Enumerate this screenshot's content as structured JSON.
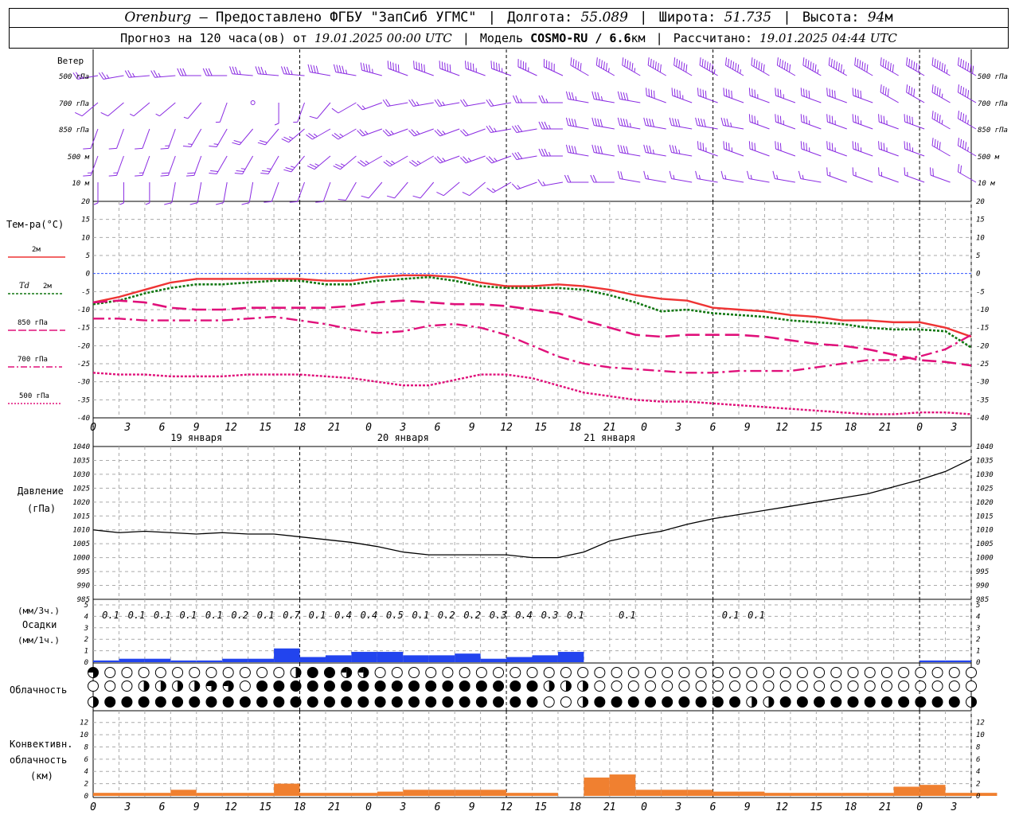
{
  "header": {
    "location": "Orenburg",
    "provider": "— Предоставлено ФГБУ \"ЗапСиб УГМС\"",
    "lon_label": "Долгота:",
    "lon_value": "55.089",
    "lat_label": "Широта:",
    "lat_value": "51.735",
    "alt_label": "Высота:",
    "alt_value": "94",
    "alt_unit": "м",
    "forecast_prefix": "Прогноз на 120 часа(ов) от",
    "forecast_time": "19.01.2025 00:00 UTC",
    "model_label": "Модель",
    "model_name": "COSMO-RU / 6.6",
    "model_unit": "км",
    "calc_label": "Рассчитано:",
    "calc_time": "19.01.2025 04:44 UTC"
  },
  "labels": {
    "wind": "Ветер",
    "wind_levels": [
      "500 гПа",
      "700 гПа",
      "850 гПа",
      "500 м",
      "10 м"
    ],
    "temp_title": "Тем-ра(°C)",
    "temp_2m": "2м",
    "td_italic": "Td",
    "td_2m": "2м",
    "t850": "850 гПа",
    "t700": "700 гПа",
    "t500": "500 гПа",
    "pressure_1": "Давление",
    "pressure_2": "(гПа)",
    "precip_unit_1": "(мм/3ч.)",
    "precip_name": "Осадки",
    "precip_unit_2": "(мм/1ч.)",
    "cloud": "Облачность",
    "conv_1": "Конвективн.",
    "conv_2": "облачность",
    "conv_3": "(км)"
  },
  "colors": {
    "wind": "#8a2be2",
    "t2m": "#ee3333",
    "td": "#117711",
    "t850": "#e0107a",
    "t700": "#e0107a",
    "t500": "#e0107a",
    "zero_line": "#3355ff",
    "pressure": "#000000",
    "precip": "#2244ee",
    "conv": "#f08030",
    "grid": "#aaaaaa"
  },
  "chart_data": [
    {
      "panel": "wind",
      "type": "wind_barbs",
      "levels": [
        "500 гПа",
        "700 гПа",
        "850 гПа",
        "500 м",
        "10 м"
      ],
      "hours": [
        0,
        3,
        6,
        9,
        12,
        15,
        18,
        21,
        24,
        27,
        30,
        33,
        36,
        39,
        42,
        45,
        48,
        51,
        54,
        57,
        60,
        63,
        66,
        69,
        72,
        75,
        78,
        81,
        84,
        87,
        90,
        93,
        96,
        99,
        102
      ],
      "speed_ms": {
        "500 гПа": [
          12,
          12,
          13,
          14,
          15,
          16,
          17,
          18,
          18,
          20,
          22,
          24,
          25,
          25,
          25,
          24,
          24,
          24,
          25,
          26,
          27,
          28,
          30,
          30,
          32,
          32,
          30,
          30,
          32,
          32,
          30,
          30,
          30,
          32,
          35
        ],
        "700 гПа": [
          6,
          5,
          4,
          4,
          2,
          2,
          1,
          2,
          3,
          5,
          6,
          8,
          10,
          12,
          12,
          10,
          10,
          12,
          14,
          18,
          18,
          20,
          20,
          22,
          20,
          20,
          18,
          18,
          20,
          20,
          20,
          20,
          20,
          22,
          25
        ],
        "850 гПа": [
          6,
          6,
          6,
          8,
          8,
          8,
          10,
          10,
          12,
          12,
          12,
          14,
          12,
          12,
          12,
          10,
          12,
          15,
          18,
          20,
          20,
          22,
          20,
          20,
          20,
          18,
          18,
          18,
          18,
          18,
          18,
          18,
          20,
          22,
          22
        ],
        "500 м": [
          8,
          8,
          8,
          10,
          10,
          10,
          12,
          12,
          12,
          14,
          12,
          12,
          12,
          12,
          12,
          12,
          14,
          16,
          18,
          20,
          20,
          20,
          18,
          18,
          18,
          18,
          16,
          16,
          18,
          18,
          18,
          18,
          18,
          20,
          22
        ],
        "10 м": [
          4,
          4,
          4,
          5,
          5,
          5,
          5,
          6,
          6,
          6,
          6,
          5,
          5,
          5,
          5,
          6,
          7,
          8,
          9,
          10,
          10,
          10,
          9,
          9,
          9,
          9,
          8,
          8,
          8,
          9,
          9,
          9,
          9,
          10,
          11
        ]
      },
      "direction_deg": {
        "500 гПа": [
          260,
          260,
          265,
          265,
          270,
          270,
          275,
          275,
          275,
          280,
          280,
          285,
          290,
          290,
          290,
          290,
          290,
          295,
          295,
          300,
          300,
          300,
          300,
          300,
          300,
          300,
          300,
          300,
          300,
          300,
          300,
          300,
          300,
          300,
          300
        ],
        "700 гПа": [
          230,
          230,
          230,
          230,
          220,
          200,
          180,
          180,
          200,
          220,
          240,
          250,
          260,
          260,
          260,
          260,
          260,
          270,
          270,
          280,
          280,
          280,
          290,
          290,
          290,
          290,
          290,
          290,
          290,
          290,
          290,
          300,
          300,
          300,
          300
        ],
        "850 гПа": [
          200,
          200,
          200,
          200,
          210,
          210,
          220,
          220,
          230,
          240,
          240,
          250,
          250,
          250,
          250,
          250,
          260,
          260,
          270,
          280,
          280,
          280,
          280,
          280,
          280,
          280,
          290,
          290,
          290,
          290,
          290,
          290,
          290,
          300,
          300
        ],
        "500 м": [
          200,
          200,
          200,
          200,
          200,
          210,
          210,
          210,
          220,
          230,
          230,
          240,
          240,
          240,
          250,
          250,
          250,
          260,
          270,
          280,
          280,
          280,
          280,
          280,
          290,
          290,
          290,
          290,
          290,
          290,
          290,
          290,
          290,
          300,
          300
        ],
        "10 м": [
          180,
          180,
          180,
          190,
          190,
          190,
          190,
          200,
          200,
          200,
          210,
          220,
          220,
          220,
          230,
          230,
          240,
          250,
          260,
          270,
          270,
          280,
          280,
          280,
          280,
          280,
          280,
          280,
          280,
          290,
          290,
          290,
          290,
          290,
          300
        ]
      }
    },
    {
      "panel": "temperature",
      "type": "line",
      "x_ticks": [
        "0",
        "3",
        "6",
        "9",
        "12",
        "15",
        "18",
        "21",
        "0",
        "3",
        "6",
        "9",
        "12",
        "15",
        "18",
        "21",
        "0",
        "3",
        "6",
        "9",
        "12",
        "15",
        "18",
        "21",
        "0",
        "3",
        "6"
      ],
      "dates": [
        "19 января",
        "20 января",
        "21 января"
      ],
      "ylim": [
        -40,
        20
      ],
      "y_ticks": [
        20,
        15,
        10,
        5,
        0,
        -5,
        -10,
        -15,
        -20,
        -25,
        -30,
        -35,
        -40
      ],
      "x_hours": [
        0,
        3,
        6,
        9,
        12,
        15,
        18,
        21,
        24,
        27,
        30,
        33,
        36,
        39,
        42,
        45,
        48,
        51,
        54,
        57,
        60,
        63,
        66,
        69,
        72,
        75,
        78,
        81,
        84,
        87,
        90,
        93,
        96,
        99,
        102
      ],
      "series": [
        {
          "name": "2м",
          "values": [
            -8,
            -6.5,
            -4.5,
            -2.5,
            -1.5,
            -1.5,
            -1.5,
            -1.5,
            -1.5,
            -2,
            -2,
            -1,
            -0.5,
            -0.5,
            -1,
            -2.5,
            -3.5,
            -3.5,
            -3,
            -3.5,
            -4.5,
            -6,
            -7,
            -7.5,
            -9.5,
            -10,
            -10.5,
            -11.5,
            -12,
            -13,
            -13,
            -13.5,
            -13.5,
            -15,
            -17.5
          ]
        },
        {
          "name": "Td 2м",
          "values": [
            -8.5,
            -7.5,
            -5.5,
            -4,
            -3,
            -3,
            -2.5,
            -2,
            -2,
            -3,
            -3,
            -2,
            -1.5,
            -1,
            -2,
            -3.5,
            -4,
            -4,
            -4,
            -4.5,
            -6,
            -8,
            -10.5,
            -10,
            -11,
            -11.5,
            -12,
            -13,
            -13.5,
            -14,
            -15,
            -15.5,
            -15.5,
            -16,
            -20.5
          ]
        },
        {
          "name": "850 гПа",
          "values": [
            -8,
            -7.5,
            -8,
            -9.5,
            -10,
            -10,
            -9.5,
            -9.5,
            -9.5,
            -9.5,
            -9,
            -8,
            -7.5,
            -8,
            -8.5,
            -8.5,
            -9,
            -10,
            -11,
            -13,
            -15,
            -17,
            -17.5,
            -17,
            -17,
            -17,
            -17.5,
            -18.5,
            -19.5,
            -20,
            -21,
            -22.5,
            -24,
            -24.5,
            -25.5
          ]
        },
        {
          "name": "700 гПа",
          "values": [
            -12.5,
            -12.5,
            -13,
            -13,
            -13,
            -13,
            -12.5,
            -12,
            -13,
            -14,
            -15.5,
            -16.5,
            -16,
            -14.5,
            -14,
            -15,
            -17,
            -20,
            -23,
            -25,
            -26,
            -26.5,
            -27,
            -27.5,
            -27.5,
            -27,
            -27,
            -27,
            -26,
            -25,
            -24,
            -24,
            -23,
            -21,
            -17
          ]
        },
        {
          "name": "500 гПа",
          "values": [
            -27.5,
            -28,
            -28,
            -28.5,
            -28.5,
            -28.5,
            -28,
            -28,
            -28,
            -28.5,
            -29,
            -30,
            -31,
            -31,
            -29.5,
            -28,
            -28,
            -29,
            -31,
            -33,
            -34,
            -35,
            -35.5,
            -35.5,
            -36,
            -36.5,
            -37,
            -37.5,
            -38,
            -38.5,
            -39,
            -39,
            -38.5,
            -38.5,
            -39
          ]
        }
      ]
    },
    {
      "panel": "pressure",
      "type": "line",
      "ylim": [
        985,
        1040
      ],
      "y_ticks": [
        1040,
        1035,
        1030,
        1025,
        1020,
        1015,
        1010,
        1005,
        1000,
        995,
        990,
        985
      ],
      "x_hours": [
        0,
        3,
        6,
        9,
        12,
        15,
        18,
        21,
        24,
        27,
        30,
        33,
        36,
        39,
        42,
        45,
        48,
        51,
        54,
        57,
        60,
        63,
        66,
        69,
        72,
        75,
        78,
        81,
        84,
        87,
        90,
        93,
        96,
        99,
        102
      ],
      "series": [
        {
          "name": "Давление",
          "values": [
            1010,
            1009,
            1009.5,
            1009,
            1008.5,
            1009,
            1008.5,
            1008.5,
            1007.5,
            1006.5,
            1005.5,
            1004,
            1002,
            1001,
            1001,
            1001,
            1001,
            1000,
            1000,
            1002,
            1006,
            1008,
            1009.5,
            1012,
            1014,
            1015.5,
            1017,
            1018.5,
            1020,
            1021.5,
            1023,
            1025.5,
            1028,
            1031,
            1035.5
          ]
        }
      ]
    },
    {
      "panel": "precipitation",
      "type": "bar",
      "ylim": [
        0,
        5
      ],
      "y_ticks": [
        5,
        4,
        3,
        2,
        1,
        0
      ],
      "labels_3h": [
        "0.1",
        "0.1",
        "0.1",
        "0.1",
        "0.1",
        "0.2",
        "0.1",
        "0.7",
        "0.1",
        "0.4",
        "0.4",
        "0.5",
        "0.1",
        "0.2",
        "0.2",
        "0.3",
        "0.4",
        "0.3",
        "0.1",
        "",
        "0.1",
        "",
        "",
        "",
        "0.1",
        "0.1"
      ],
      "x_hours": [
        0,
        3,
        6,
        9,
        12,
        15,
        18,
        21,
        24,
        27,
        30,
        33,
        36,
        39,
        42,
        45,
        48,
        51,
        54,
        57,
        60,
        63,
        66,
        69,
        72,
        75,
        78,
        81,
        84,
        87,
        90,
        93,
        96,
        99,
        102
      ],
      "values": [
        0.05,
        0.1,
        0.1,
        0.05,
        0.05,
        0.1,
        0.1,
        0.4,
        0.15,
        0.2,
        0.3,
        0.3,
        0.2,
        0.2,
        0.25,
        0.1,
        0.15,
        0.2,
        0.3,
        0,
        0,
        0,
        0,
        0,
        0,
        0,
        0,
        0,
        0,
        0,
        0,
        0,
        0.05,
        0.05,
        0
      ]
    },
    {
      "panel": "cloud_cover",
      "type": "symbols",
      "rows": [
        "high",
        "middle",
        "low"
      ],
      "x_hours": [
        0,
        3,
        6,
        9,
        12,
        15,
        18,
        21,
        24,
        27,
        30,
        33,
        36,
        39,
        42,
        45,
        48,
        51,
        54,
        57,
        60,
        63,
        66,
        69,
        72,
        75,
        78,
        81,
        84,
        87,
        90,
        93,
        96,
        99,
        102
      ],
      "oktas": {
        "high": [
          6,
          0,
          0,
          0,
          0,
          0,
          0,
          0,
          5,
          8,
          6,
          0,
          0,
          0,
          0,
          0,
          0,
          0,
          0,
          0,
          0,
          0,
          0,
          0,
          0,
          0,
          0,
          0,
          0,
          0,
          0,
          0,
          0,
          0,
          0
        ],
        "middle": [
          0,
          0,
          4,
          4,
          4,
          6,
          0,
          8,
          8,
          8,
          8,
          8,
          8,
          8,
          8,
          8,
          8,
          8,
          4,
          4,
          0,
          0,
          0,
          0,
          0,
          0,
          0,
          0,
          0,
          0,
          0,
          0,
          0,
          0,
          0
        ],
        "low": [
          4,
          8,
          8,
          8,
          8,
          8,
          8,
          8,
          8,
          8,
          8,
          8,
          8,
          8,
          8,
          8,
          8,
          8,
          0,
          4,
          8,
          8,
          8,
          8,
          8,
          8,
          4,
          8,
          8,
          8,
          8,
          8,
          8,
          8,
          4
        ]
      }
    },
    {
      "panel": "convective_cloud",
      "type": "bar",
      "ylim": [
        0,
        13
      ],
      "y_ticks": [
        12,
        10,
        8,
        6,
        4,
        2,
        0
      ],
      "x_hours": [
        0,
        3,
        6,
        9,
        12,
        15,
        18,
        21,
        24,
        27,
        30,
        33,
        36,
        39,
        42,
        45,
        48,
        51,
        54,
        57,
        60,
        63,
        66,
        69,
        72,
        75,
        78,
        81,
        84,
        87,
        90,
        93,
        96,
        99,
        102
      ],
      "values": [
        0.5,
        0.5,
        0.5,
        1,
        0.5,
        0.5,
        0.5,
        2,
        0.5,
        0.5,
        0.5,
        0.7,
        1,
        1,
        1,
        1,
        0.5,
        0.5,
        0,
        3,
        3.5,
        1,
        1,
        1,
        0.7,
        0.7,
        0.5,
        0.5,
        0.5,
        0.5,
        0.5,
        1.5,
        1.8,
        0.5,
        0.5
      ]
    }
  ]
}
